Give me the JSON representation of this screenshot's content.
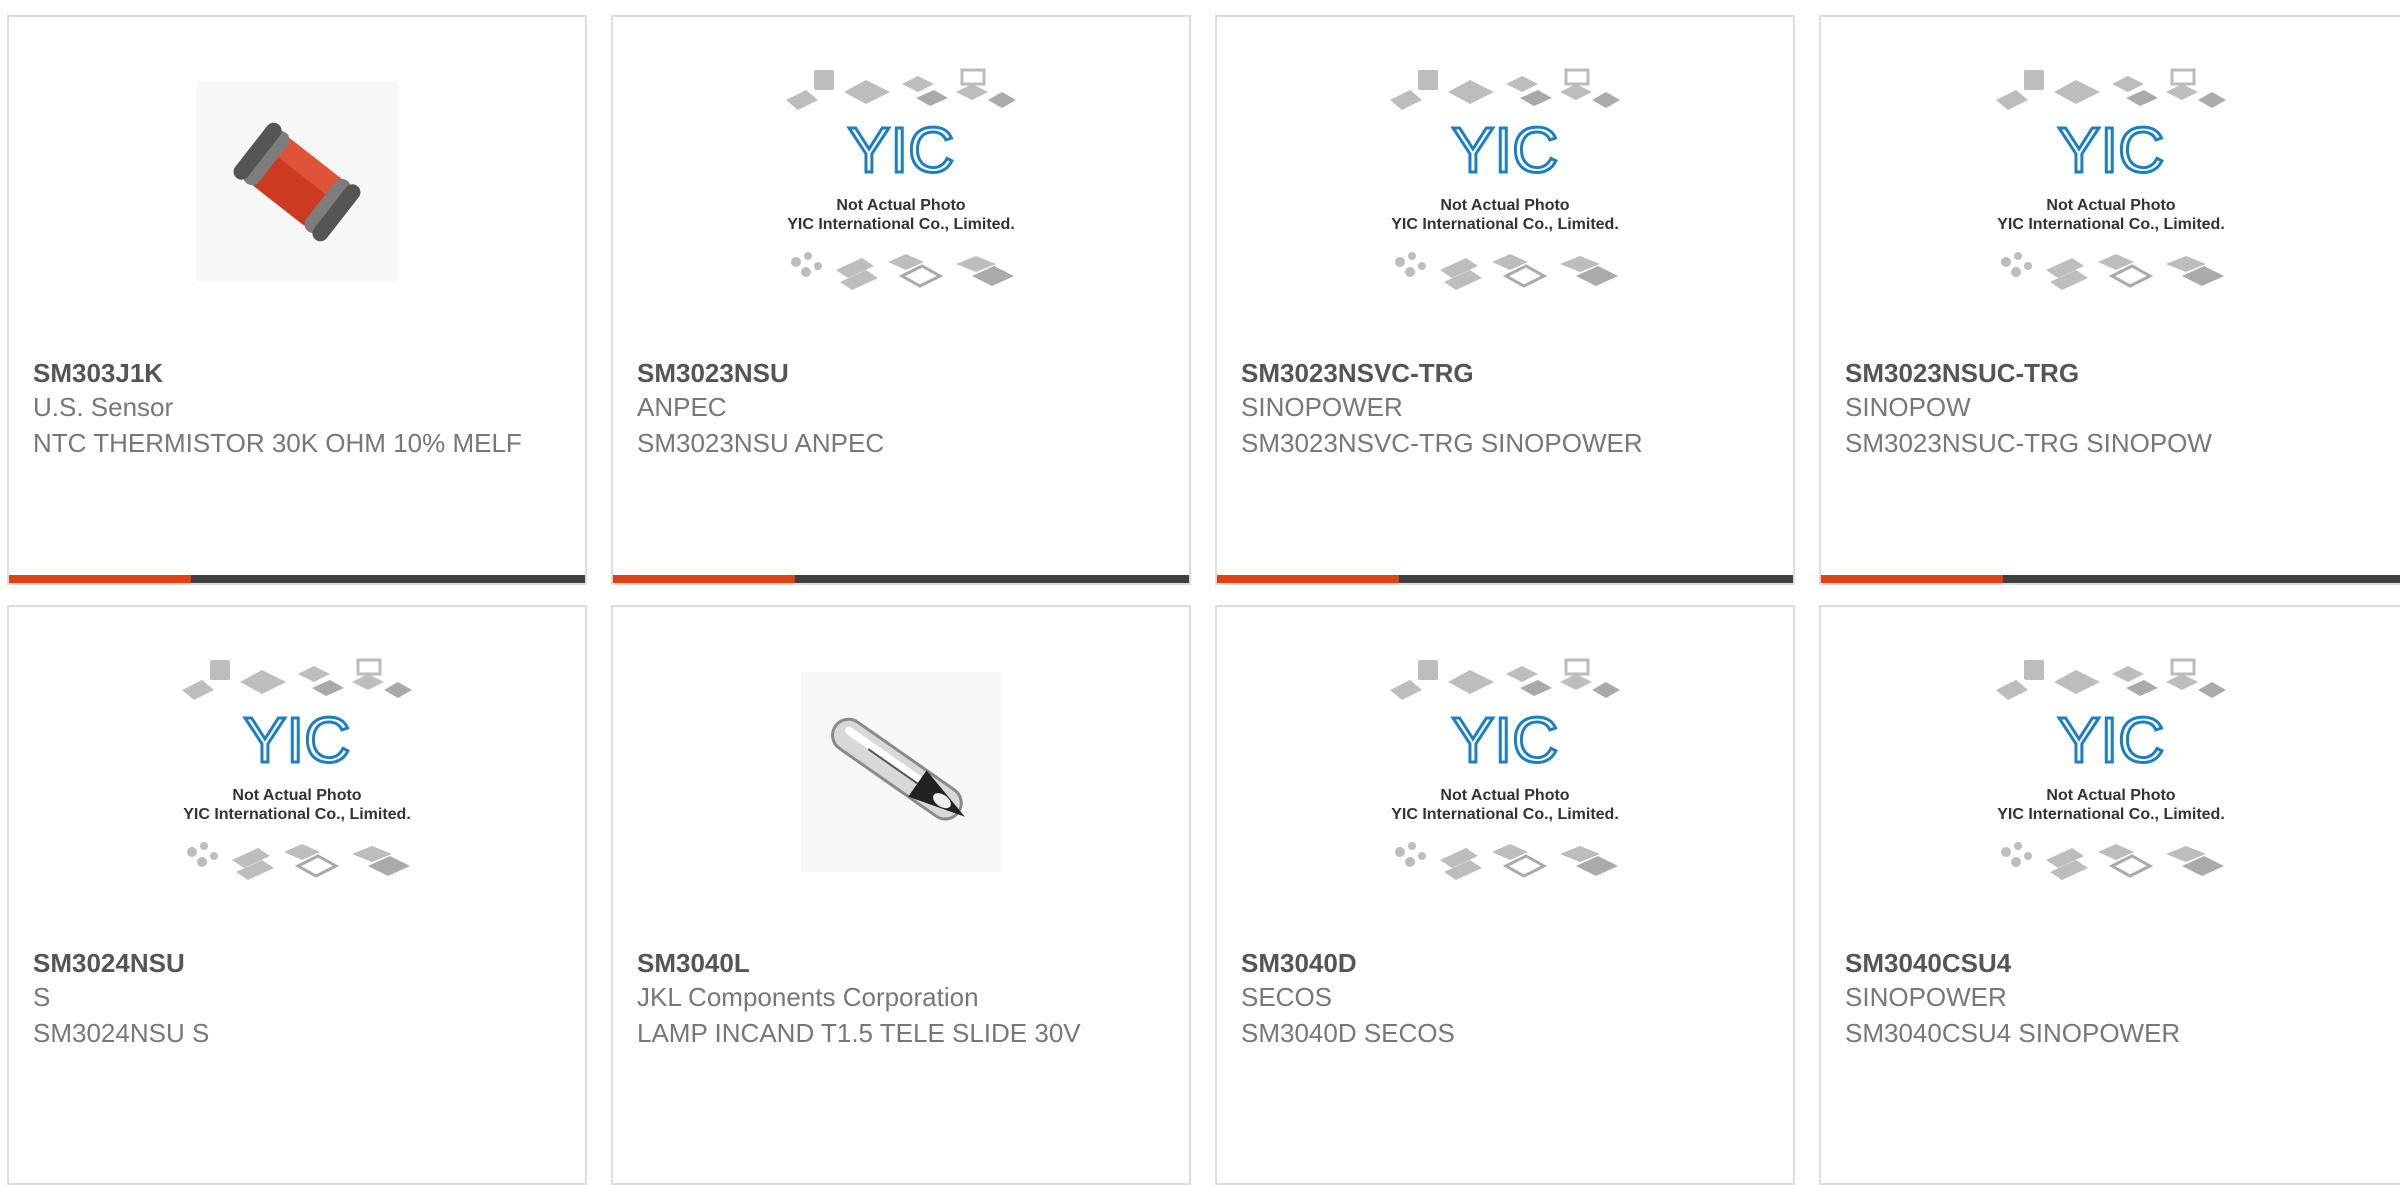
{
  "colors": {
    "accent": "#e2400f",
    "bar": "#3f3f3f",
    "border": "#dcdcdc",
    "title": "#555555",
    "body": "#777777",
    "logo": "#1d7fc1"
  },
  "placeholder": {
    "logo_text": "YIC",
    "line1": "Not Actual Photo",
    "line2": "YIC International Co., Limited."
  },
  "products": [
    {
      "part_number": "SM303J1K",
      "manufacturer": "U.S. Sensor",
      "description": "NTC THERMISTOR 30K OHM 10% MELF",
      "image": "melf-thermistor-photo"
    },
    {
      "part_number": "SM3023NSU",
      "manufacturer": "ANPEC",
      "description": "SM3023NSU ANPEC",
      "image": "yic-placeholder"
    },
    {
      "part_number": "SM3023NSVC-TRG",
      "manufacturer": "SINOPOWER",
      "description": "SM3023NSVC-TRG SINOPOWER",
      "image": "yic-placeholder"
    },
    {
      "part_number": "SM3023NSUC-TRG",
      "manufacturer": "SINOPOW",
      "description": "SM3023NSUC-TRG SINOPOW",
      "image": "yic-placeholder"
    },
    {
      "part_number": "SM3024NSU",
      "manufacturer": "S",
      "description": "SM3024NSU S",
      "image": "yic-placeholder"
    },
    {
      "part_number": "SM3040L",
      "manufacturer": "JKL Components Corporation",
      "description": "LAMP INCAND T1.5 TELE SLIDE 30V",
      "image": "incandescent-lamp-photo"
    },
    {
      "part_number": "SM3040D",
      "manufacturer": "SECOS",
      "description": "SM3040D SECOS",
      "image": "yic-placeholder"
    },
    {
      "part_number": "SM3040CSU4",
      "manufacturer": "SINOPOWER",
      "description": "SM3040CSU4 SINOPOWER",
      "image": "yic-placeholder"
    }
  ]
}
